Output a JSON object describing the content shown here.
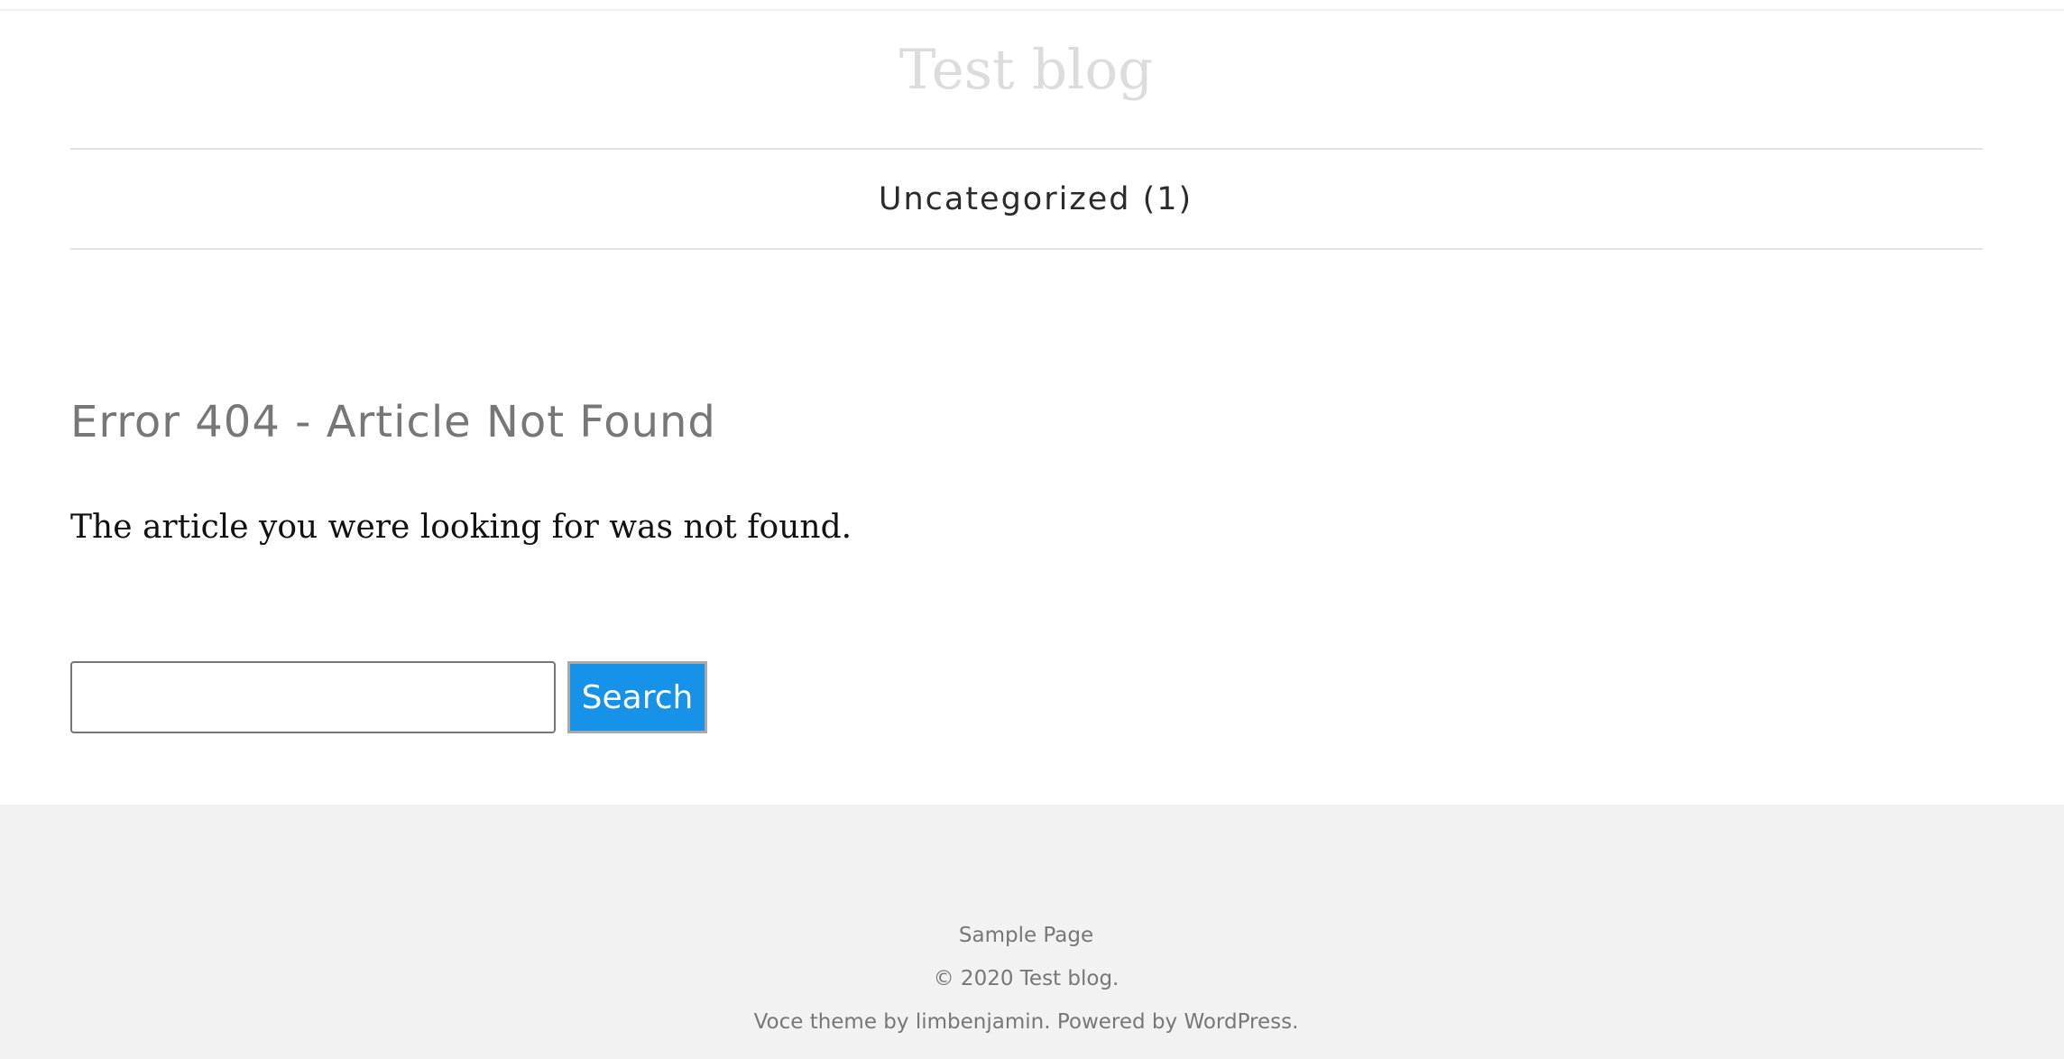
{
  "header": {
    "site_title": "Test blog"
  },
  "nav": {
    "items": [
      {
        "label": "Uncategorized (1)"
      }
    ]
  },
  "main": {
    "error_title": "Error 404 - Article Not Found",
    "error_message": "The article you were looking for was not found.",
    "search": {
      "value": "",
      "placeholder": "",
      "button_label": "Search"
    }
  },
  "footer": {
    "menu_link": "Sample Page",
    "copyright": "© 2020 Test blog.",
    "credit_prefix": "Voce theme by ",
    "credit_author": "limbenjamin",
    "credit_middle": ". Powered by ",
    "credit_platform": "WordPress",
    "credit_suffix": "."
  },
  "colors": {
    "accent": "#1693e8",
    "footer_bg": "#f2f2f2",
    "title": "#dcdcdc"
  }
}
